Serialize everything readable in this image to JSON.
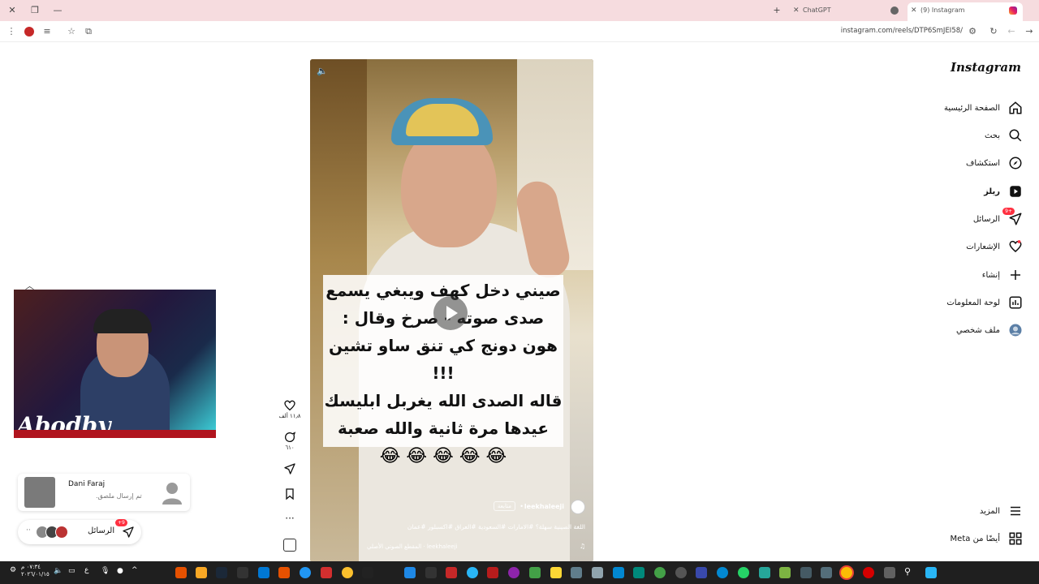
{
  "browser": {
    "tabs": [
      {
        "title": "(9) Instagram",
        "active": true
      },
      {
        "title": "ChatGPT",
        "active": false
      }
    ],
    "url": "instagram.com/reels/DTP6SmJEI58/"
  },
  "nav": {
    "logo": "Instagram",
    "items": [
      {
        "label": "الصفحة الرئيسية",
        "icon": "home-icon"
      },
      {
        "label": "بحث",
        "icon": "search-icon"
      },
      {
        "label": "استكشاف",
        "icon": "compass-icon"
      },
      {
        "label": "ريلز",
        "icon": "reels-icon"
      },
      {
        "label": "الرسائل",
        "icon": "messenger-icon",
        "badge": "+9"
      },
      {
        "label": "الإشعارات",
        "icon": "heart-icon"
      },
      {
        "label": "إنشاء",
        "icon": "plus-icon"
      },
      {
        "label": "لوحة المعلومات",
        "icon": "dashboard-icon"
      },
      {
        "label": "ملف شخصي",
        "icon": "profile-avatar-icon"
      }
    ],
    "more": "المزيد",
    "also_from_meta": "أيضًا من Meta"
  },
  "reel": {
    "caption_lines": [
      "صيني دخل كهف ويبغي يسمع",
      "صدى صوته - صرخ وقال :",
      "هون دونج كي تنق ساو تشين !!!",
      "قاله الصدى الله يغربل ابليسك",
      "عيدها مرة ثانية والله صعبة"
    ],
    "emojis": "😂 😂 😂 😂 😂",
    "author": "leekhaleeji",
    "follow": "متابعة",
    "description": "اللغة الصينية سهلة؟ #الامارات #السعودية #العراق #اكسبلور #عمان",
    "audio": "leekhaleeji · المقطع الصوتي الأصلي",
    "likes": "١١٫٨ ألف",
    "comments": "٦١٠"
  },
  "overlay": {
    "streamer_tag": "Abodby",
    "chat_name": "Dani Faraj",
    "chat_status": "تم إرسال ملصق.",
    "messages_label": "الرسائل",
    "messages_badge": "+9"
  },
  "taskbar": {
    "time": "٠٧:٣٤ م",
    "date": "٢٠٢٦/٠١/١٥",
    "lang": "ع"
  },
  "colors": {
    "tabbar": "#f6dcdf",
    "badge": "#ff3040",
    "taskbar": "#1f1f1f"
  }
}
